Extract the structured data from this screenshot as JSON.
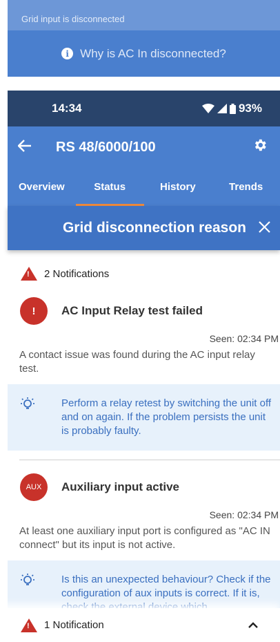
{
  "top_banner": {
    "status_text": "Grid input is disconnected",
    "why_text": "Why is AC In disconnected?"
  },
  "status_bar": {
    "time": "14:34",
    "battery": "93%"
  },
  "app_bar": {
    "title": "RS 48/6000/100"
  },
  "tabs": [
    {
      "label": "Overview",
      "active": false
    },
    {
      "label": "Status",
      "active": true
    },
    {
      "label": "History",
      "active": false
    },
    {
      "label": "Trends",
      "active": false
    }
  ],
  "sheet": {
    "title": "Grid disconnection reason",
    "notification_count": "2 Notifications"
  },
  "notifications": [
    {
      "badge": "!",
      "title": "AC Input Relay test failed",
      "seen": "Seen: 02:34 PM",
      "description": "A contact issue was found during the AC input relay test.",
      "tip": "Perform a relay retest by switching the unit off and on again. If the problem persists the unit is probably faulty."
    },
    {
      "badge": "AUX",
      "title": "Auxiliary input active",
      "seen": "Seen: 02:34 PM",
      "description": "At least one auxiliary input port is configured as \"AC IN connect\" but its input is not active.",
      "tip": "Is this an unexpected behaviour? Check if the configuration of aux inputs is correct. If it is, check the external device which"
    }
  ],
  "bottom_bar": {
    "label": "1 Notification"
  },
  "colors": {
    "primary": "#4a7fce",
    "status_bar": "#29446b",
    "alert": "#c8322a",
    "tab_indicator": "#f08a3c",
    "tip_bg": "#e7f1fb"
  }
}
